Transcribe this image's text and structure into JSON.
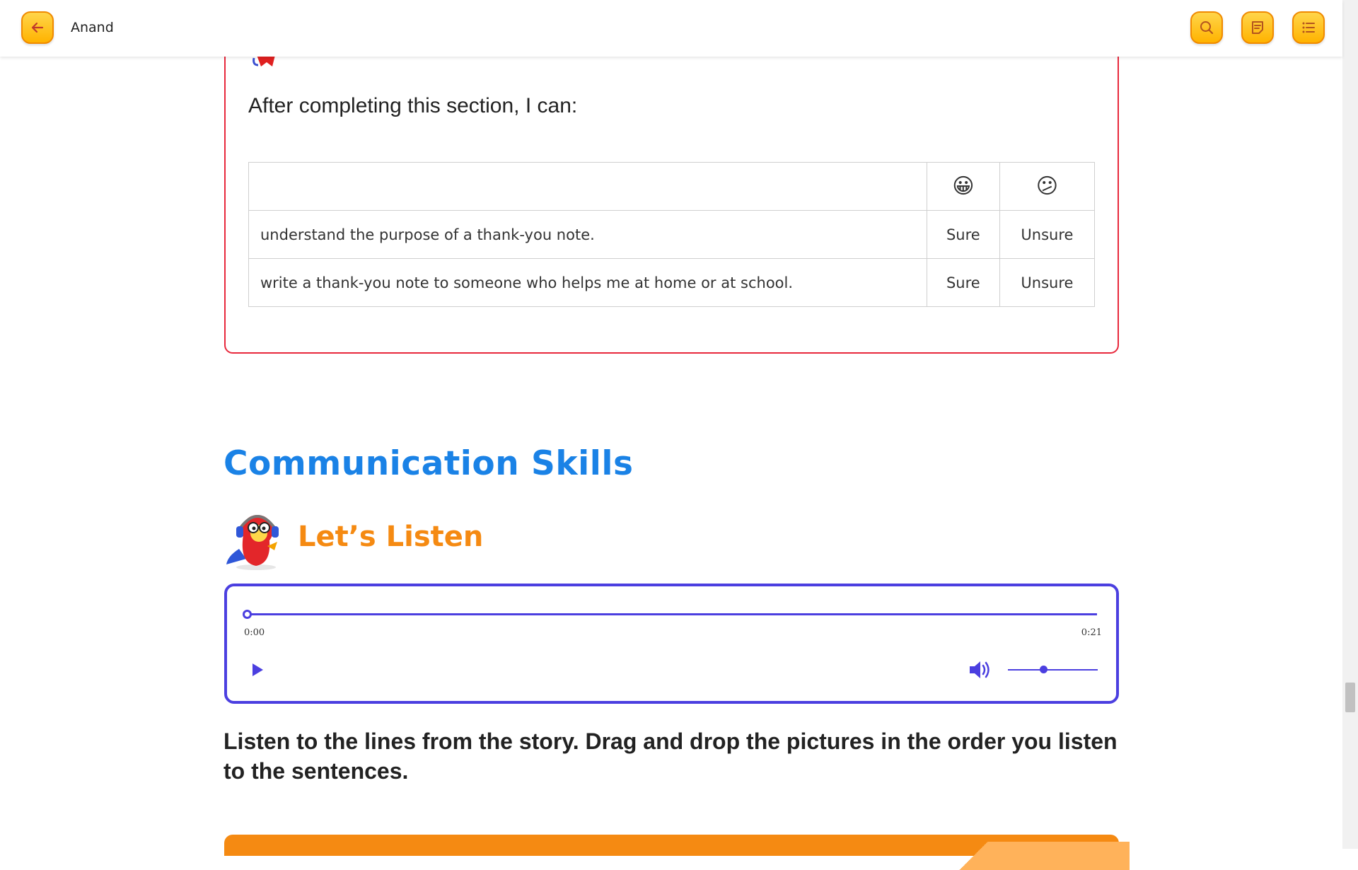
{
  "topbar": {
    "user_name": "Anand",
    "back_icon": "arrow-left-icon",
    "search_icon": "search-icon",
    "notes_icon": "notes-icon",
    "menu_icon": "list-menu-icon",
    "accent_color": "#ffb300"
  },
  "outcomes": {
    "heading": "After completing this section, I can:",
    "header_icons": [
      "😀",
      "😕"
    ],
    "rows": [
      {
        "statement": "understand the purpose of a thank-you note.",
        "sure": "Sure",
        "unsure": "Unsure"
      },
      {
        "statement": "write a thank-you note to someone who helps me at home or at school.",
        "sure": "Sure",
        "unsure": "Unsure"
      }
    ],
    "border_color": "#e8283c"
  },
  "communication": {
    "section_title": "Communication Skills",
    "subsection_title": "Let’s Listen",
    "audio": {
      "current_time": "0:00",
      "duration": "0:21",
      "progress": 0.0,
      "volume": 0.4,
      "play_icon": "play-icon",
      "volume_icon": "volume-icon"
    },
    "instruction": "Listen to the lines from the story. Drag and drop the pictures in the order you listen to the sentences."
  }
}
